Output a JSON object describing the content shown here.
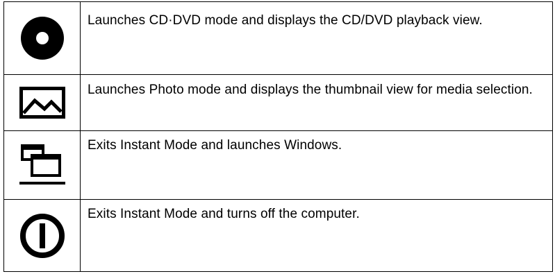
{
  "rows": [
    {
      "icon": "disc-icon",
      "description": "Launches CD·DVD mode and displays the CD/DVD playback view."
    },
    {
      "icon": "photo-icon",
      "description": "Launches Photo mode and displays the thumbnail view for media selection."
    },
    {
      "icon": "windows-switch-icon",
      "description": "Exits Instant Mode and launches Windows."
    },
    {
      "icon": "power-icon",
      "description": "Exits Instant Mode and turns off the computer."
    }
  ]
}
